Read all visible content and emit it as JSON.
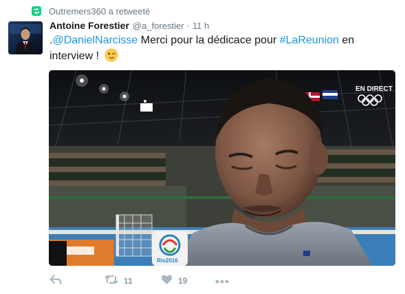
{
  "retweet": {
    "text": "Outremers360 a retweeté",
    "icon": "retweet-badge-icon",
    "color": "#19cf86"
  },
  "tweet": {
    "author_name": "Antoine Forestier",
    "handle": "@a_forestier",
    "separator": "·",
    "time": "11 h",
    "text_prefix": ".",
    "mention": "@DanielNarcisse",
    "text_middle": " Merci pour la dédicace pour ",
    "hashtag": "#LaReunion",
    "text_suffix": " en interview !",
    "emoji": "winking-face-emoji"
  },
  "media": {
    "overlay_text": "EN DIRECT",
    "sign_text": "Rio2016"
  },
  "actions": {
    "reply_icon": "reply-icon",
    "retweet_icon": "retweet-icon",
    "retweet_count": "11",
    "like_icon": "heart-icon",
    "like_count": "19",
    "more_icon": "more-icon"
  },
  "colors": {
    "link": "#1b95e0",
    "muted": "#657786",
    "action": "#8899a6"
  }
}
